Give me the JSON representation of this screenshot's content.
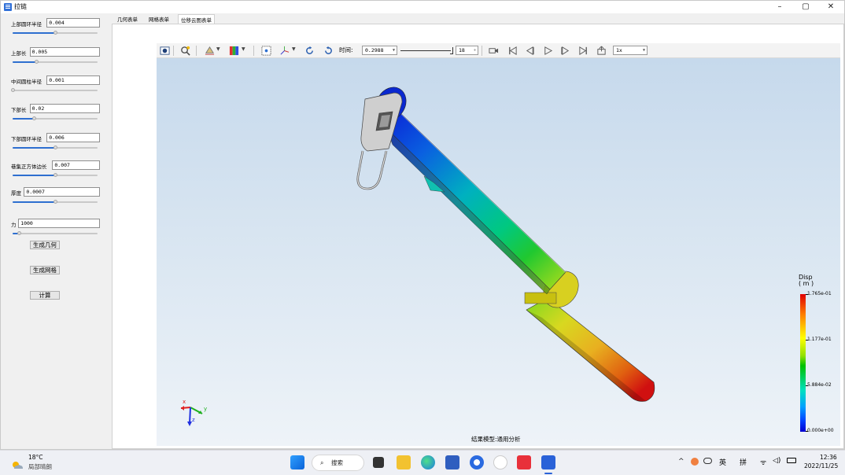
{
  "window": {
    "title": "拉链",
    "controls": {
      "minimize": "–",
      "maximize": "▢",
      "close": "✕"
    }
  },
  "params": [
    {
      "label": "上部圆环半径",
      "value": "0.004",
      "slider": 0.5
    },
    {
      "label": "上部长",
      "value": "0.005",
      "slider": 0.28
    },
    {
      "label": "中间圆柱半径",
      "value": "0.001",
      "slider": 0.0
    },
    {
      "label": "下部长",
      "value": "0.02",
      "slider": 0.25
    },
    {
      "label": "下部圆环半径",
      "value": "0.006",
      "slider": 0.5
    },
    {
      "label": "巷集正方体边长",
      "value": "0.007",
      "slider": 0.5
    },
    {
      "label": "厚度",
      "value": "0.0007",
      "slider": 0.5
    },
    {
      "label": "力",
      "value": "1000",
      "slider": 0.07
    }
  ],
  "buttons": {
    "gen_geometry": "生成几何",
    "gen_mesh": "生成网格",
    "compute": "计算"
  },
  "tabs": [
    "几何表单",
    "网格表单",
    "位移云图表单"
  ],
  "active_tab": 2,
  "toolbar": {
    "time_label": "时间:",
    "time_value": "0.2988",
    "frame_value": "18",
    "speed_value": "1x"
  },
  "legend": {
    "title_line1": "Disp",
    "title_line2": "( m )",
    "max": "1.765e-01",
    "v2": "1.177e-01",
    "v3": "5.884e-02",
    "min": "0.000e+00"
  },
  "axes": {
    "x": "x",
    "y": "y",
    "z": "z"
  },
  "result_model_label": "结果模型:通用分析",
  "taskbar": {
    "weather_temp": "18°C",
    "weather_desc": "局部晴朗",
    "search": "搜索",
    "ime1": "英",
    "ime2": "拼",
    "time": "12:36",
    "date": "2022/11/25"
  },
  "colors": {
    "accent": "#2e6fd0",
    "legend_max": "#e00000",
    "legend_min": "#0000d0"
  }
}
